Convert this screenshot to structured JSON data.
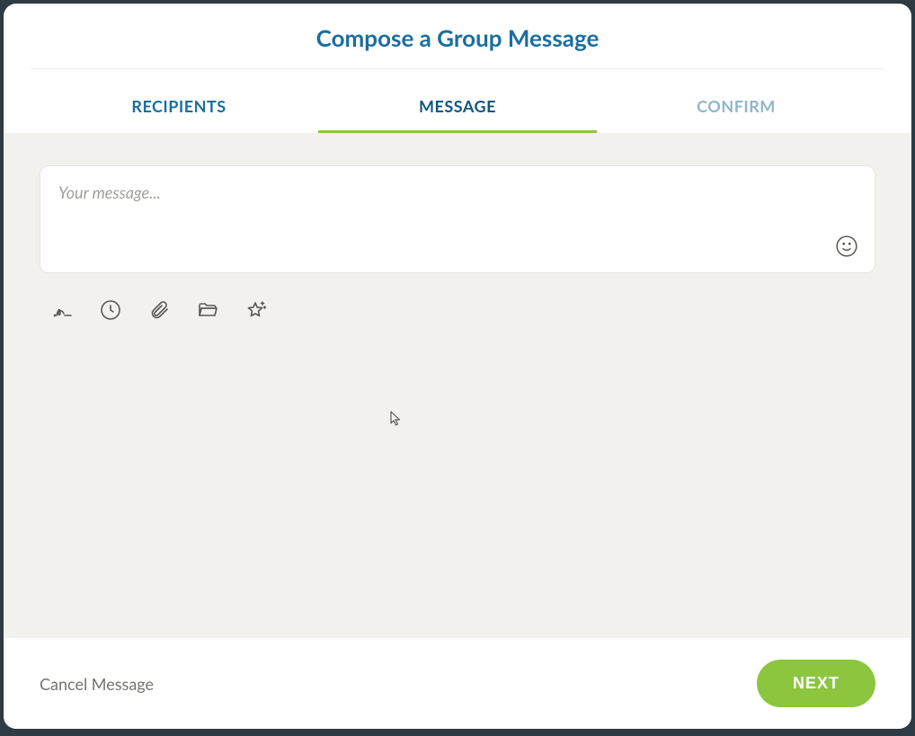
{
  "header": {
    "title": "Compose a Group Message"
  },
  "tabs": {
    "recipients": "RECIPIENTS",
    "message": "MESSAGE",
    "confirm": "CONFIRM"
  },
  "composer": {
    "placeholder": "Your message...",
    "value": ""
  },
  "icons": {
    "signature": "signature-icon",
    "schedule": "clock-icon",
    "attachment": "paperclip-icon",
    "folder": "folder-icon",
    "sparkle": "sparkle-star-icon",
    "emoji": "smile-icon"
  },
  "footer": {
    "cancel": "Cancel Message",
    "next": "NEXT"
  }
}
